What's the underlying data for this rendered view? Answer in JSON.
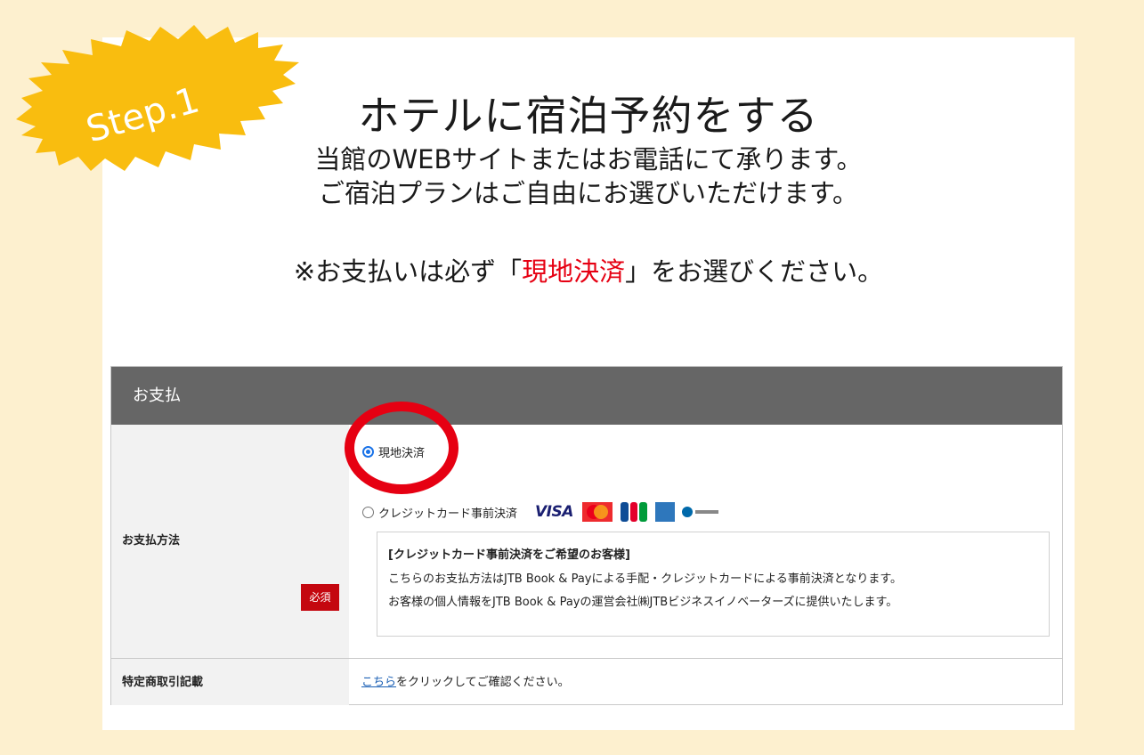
{
  "step_label": "Step.1",
  "hero": {
    "title": "ホテルに宿泊予約をする",
    "line1": "当館のWEBサイトまたはお電話にて承ります。",
    "line2": "ご宿泊プランはご自由にお選びいただけます。",
    "note_prefix": "※お支払いは必ず「",
    "note_highlight": "現地決済",
    "note_suffix": "」をお選びください。"
  },
  "form": {
    "header": "お支払",
    "payment_method_label": "お支払方法",
    "required_badge": "必須",
    "options": [
      {
        "label": "現地決済",
        "selected": true
      },
      {
        "label": "クレジットカード事前決済",
        "selected": false
      }
    ],
    "card_brands": [
      "VISA",
      "Mastercard",
      "JCB",
      "American Express",
      "Diners Club"
    ],
    "visa_text": "VISA",
    "info": {
      "title": "[クレジットカード事前決済をご希望のお客様]",
      "line1": "こちらのお支払方法はJTB Book & Payによる手配・クレジットカードによる事前決済となります。",
      "line2": "お客様の個人情報をJTB Book & Payの運営会社㈱JTBビジネスイノベーターズに提供いたします。"
    },
    "legal_label": "特定商取引記載",
    "legal_link": "こちら",
    "legal_suffix": "をクリックしてご確認ください。"
  },
  "colors": {
    "background": "#fdf0cf",
    "banner": "#f9bd0f",
    "highlight_red": "#e60012",
    "panel_header": "#666666",
    "badge": "#c4070f"
  }
}
